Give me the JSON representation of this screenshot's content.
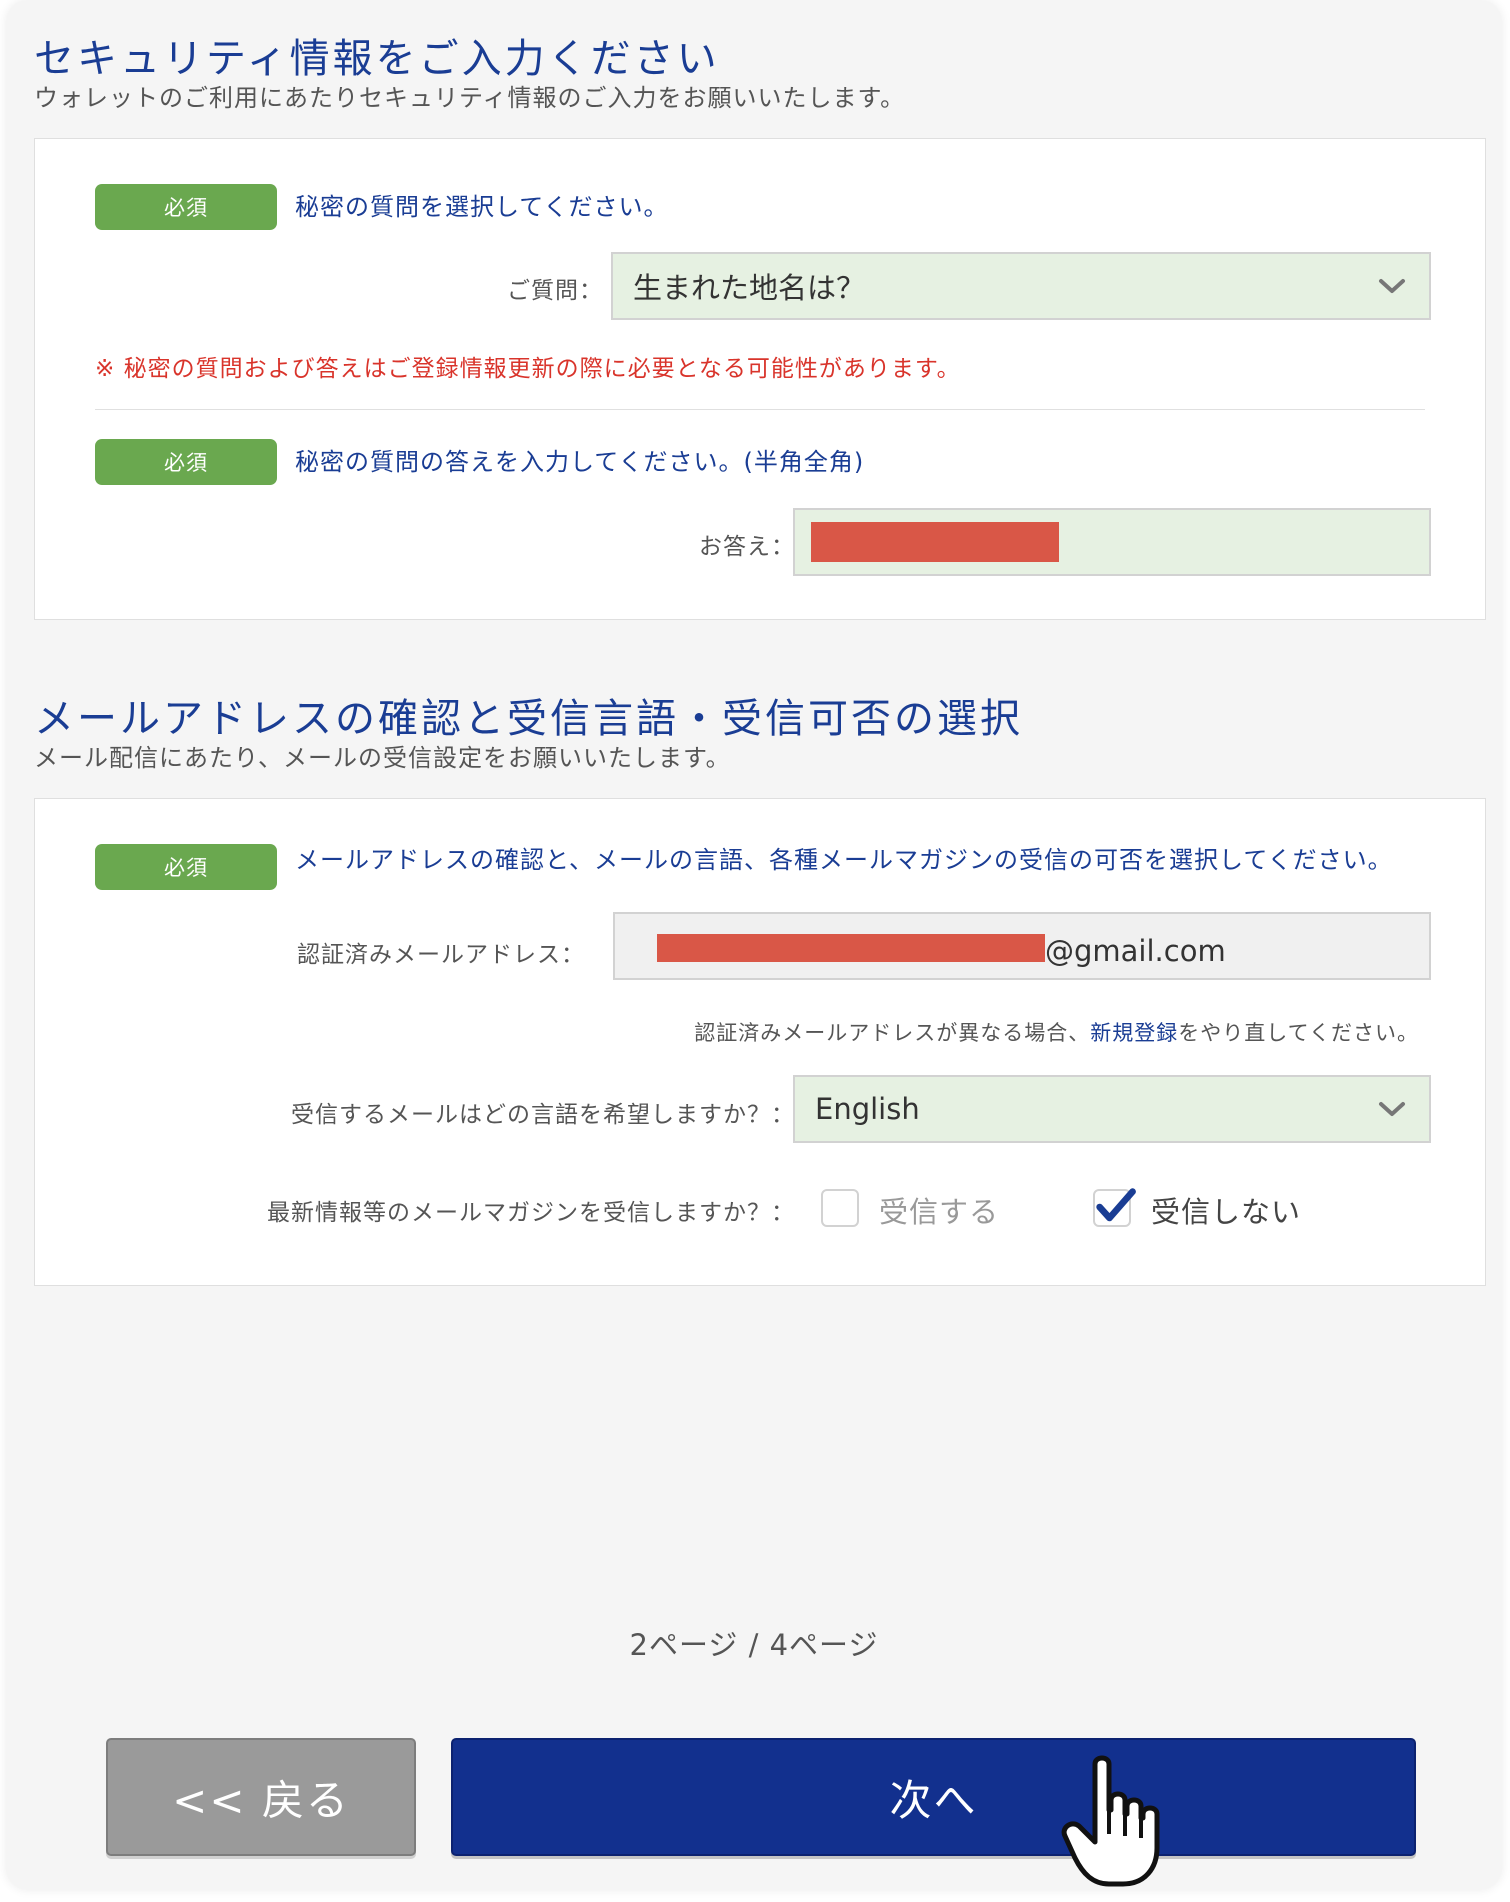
{
  "security": {
    "title": "セキュリティ情報をご入力ください",
    "subtitle": "ウォレットのご利用にあたりセキュリティ情報のご入力をお願いいたします。",
    "question_block": {
      "required_badge": "必須",
      "instruction": "秘密の質問を選択してください。",
      "label": "ご質問：",
      "selected_value": "生まれた地名は？"
    },
    "warning": "※ 秘密の質問および答えはご登録情報更新の際に必要となる可能性があります。",
    "answer_block": {
      "required_badge": "必須",
      "instruction": "秘密の質問の答えを入力してください。(半角全角)",
      "label": "お答え："
    }
  },
  "mail": {
    "title": "メールアドレスの確認と受信言語・受信可否の選択",
    "subtitle": "メール配信にあたり、メールの受信設定をお願いいたします。",
    "required_badge": "必須",
    "instruction": "メールアドレスの確認と、メールの言語、各種メールマガジンの受信の可否を選択してください。",
    "email_label": "認証済みメールアドレス：",
    "email_suffix": "@gmail.com",
    "help_prefix": "認証済みメールアドレスが異なる場合、",
    "help_link": "新規登録",
    "help_suffix": "をやり直してください。",
    "language_label": "受信するメールはどの言語を希望しますか？：",
    "language_value": "English",
    "magazine_label": "最新情報等のメールマガジンを受信しますか？：",
    "opt_in_label": "受信する",
    "opt_out_label": "受信しない",
    "opt_in_checked": false,
    "opt_out_checked": true
  },
  "pager": {
    "text": "2ページ / 4ページ"
  },
  "buttons": {
    "back": "<< 戻る",
    "next": "次へ"
  },
  "colors": {
    "accent": "#1a3d94",
    "required": "#6aa84f",
    "warning": "#d9342b",
    "next_button": "#12308e",
    "back_button": "#9a9a9a",
    "field_bg": "#e6f1e2",
    "redaction": "#d95747"
  },
  "icons": {
    "select_chevron": "chevron-down-icon",
    "checkmark": "checkmark-icon",
    "cursor": "hand-pointer-icon"
  }
}
